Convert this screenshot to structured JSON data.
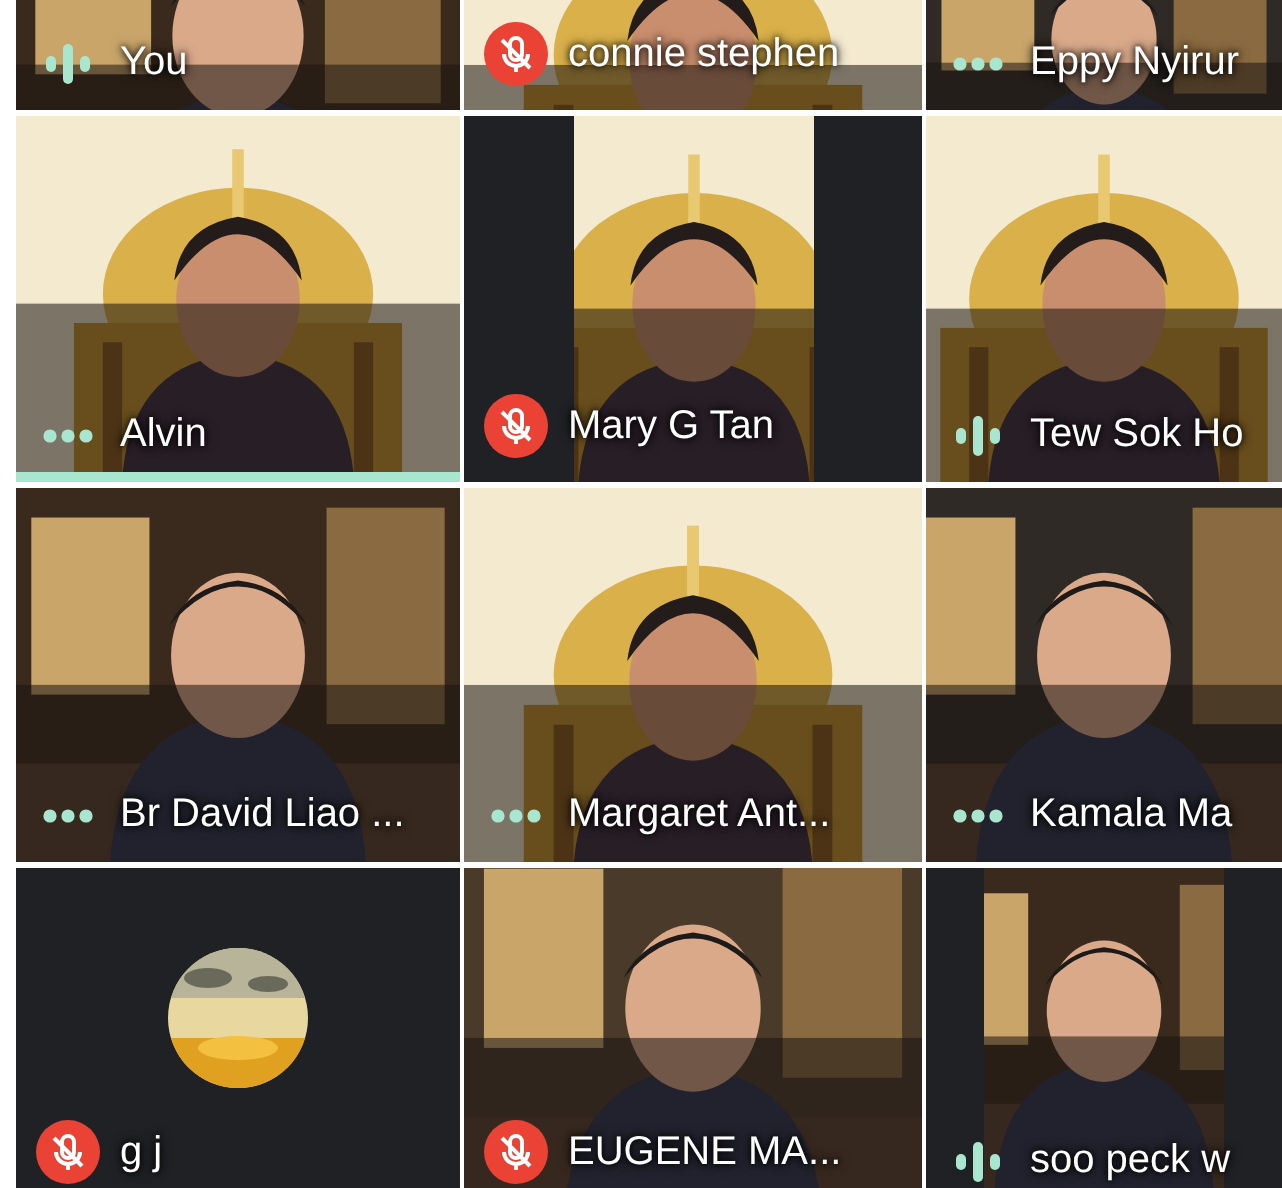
{
  "tiles": [
    {
      "name": "You",
      "muted": false,
      "speaking": true,
      "camera_off": false,
      "pillarbox": false,
      "highlighted": false
    },
    {
      "name": "connie stephen",
      "muted": true,
      "speaking": false,
      "camera_off": false,
      "pillarbox": false,
      "highlighted": false
    },
    {
      "name": "Eppy Nyirur",
      "muted": false,
      "speaking": false,
      "camera_off": false,
      "pillarbox": false,
      "highlighted": false
    },
    {
      "name": "Alvin",
      "muted": false,
      "speaking": false,
      "camera_off": false,
      "pillarbox": false,
      "highlighted": true
    },
    {
      "name": "Mary G Tan",
      "muted": true,
      "speaking": false,
      "camera_off": false,
      "pillarbox": true,
      "highlighted": false
    },
    {
      "name": "Tew Sok Ho",
      "muted": false,
      "speaking": true,
      "camera_off": false,
      "pillarbox": false,
      "highlighted": false
    },
    {
      "name": "Br David Liao ...",
      "muted": false,
      "speaking": false,
      "camera_off": false,
      "pillarbox": false,
      "highlighted": false
    },
    {
      "name": "Margaret Ant...",
      "muted": false,
      "speaking": false,
      "camera_off": false,
      "pillarbox": false,
      "highlighted": false
    },
    {
      "name": "Kamala Ma",
      "muted": false,
      "speaking": false,
      "camera_off": false,
      "pillarbox": false,
      "highlighted": false
    },
    {
      "name": "g j",
      "muted": true,
      "speaking": false,
      "camera_off": true,
      "pillarbox": false,
      "highlighted": false
    },
    {
      "name": "EUGENE MA...",
      "muted": true,
      "speaking": false,
      "camera_off": false,
      "pillarbox": false,
      "highlighted": false
    },
    {
      "name": "soo peck w",
      "muted": false,
      "speaking": true,
      "camera_off": false,
      "pillarbox": true,
      "highlighted": false
    }
  ]
}
